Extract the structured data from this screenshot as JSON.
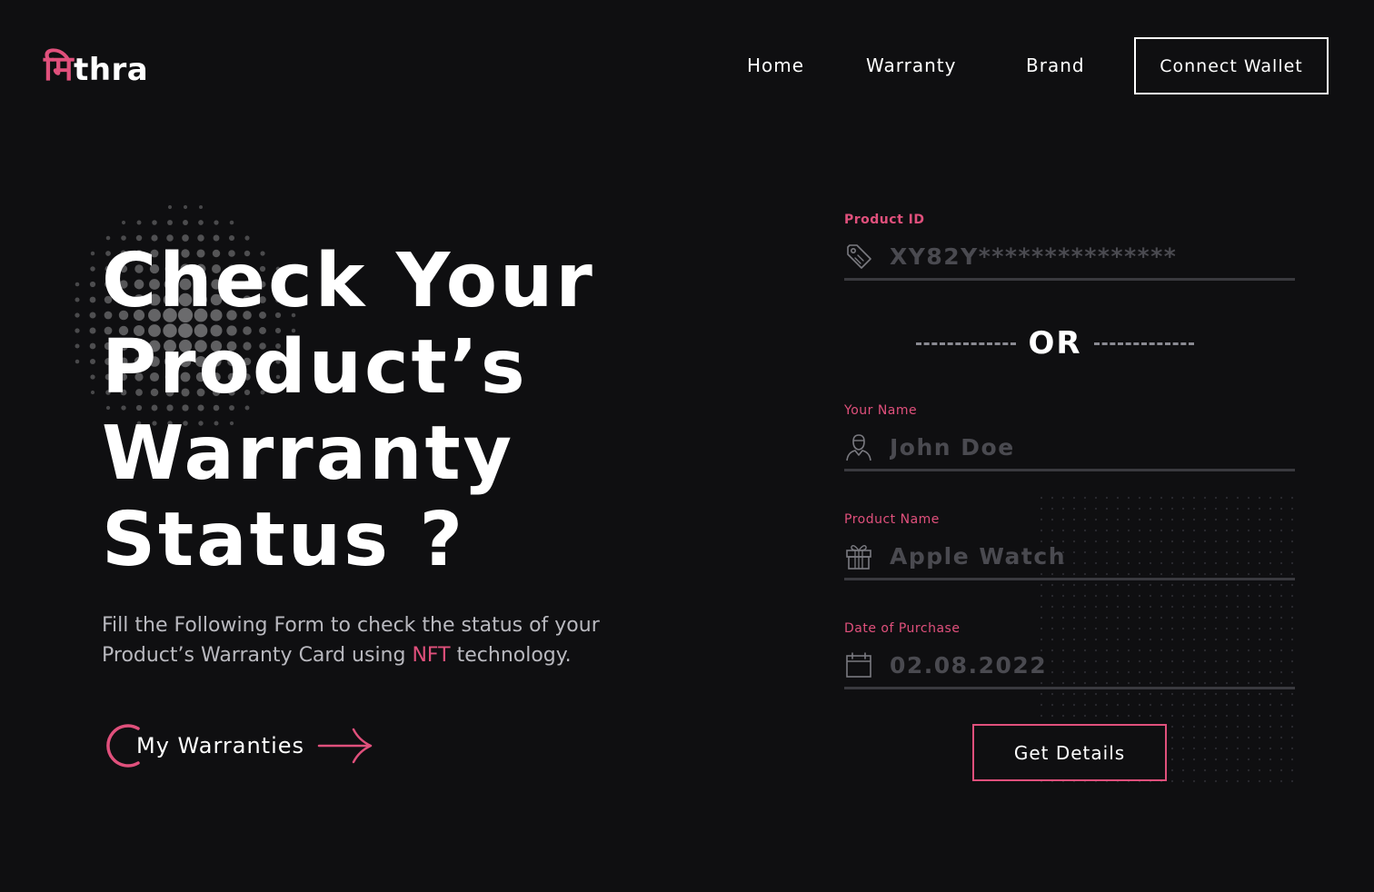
{
  "brand": {
    "logo_deva": "मि",
    "logo_latin": "thra"
  },
  "nav": {
    "home": "Home",
    "warranty": "Warranty",
    "brand": "Brand",
    "connect_wallet": "Connect Wallet"
  },
  "hero": {
    "title_lines": [
      "Check Your",
      "Product’s",
      "Warranty",
      "Status ?"
    ],
    "desc_before": "Fill the Following Form to check the status of your Product’s Warranty Card using ",
    "desc_accent": "NFT",
    "desc_after": " technology.",
    "cta": "My Warranties"
  },
  "form": {
    "product_id": {
      "label": "Product ID",
      "placeholder": "XY82Y***************",
      "icon": "tag-icon"
    },
    "or_text": "OR",
    "your_name": {
      "label": "Your Name",
      "placeholder": "John Doe",
      "icon": "user-icon"
    },
    "product_name": {
      "label": "Product Name",
      "placeholder": "Apple Watch",
      "icon": "gift-icon"
    },
    "date_of_purchase": {
      "label": "Date of Purchase",
      "placeholder": "02.08.2022",
      "icon": "calendar-icon"
    },
    "submit": "Get Details"
  },
  "colors": {
    "background": "#0f0f11",
    "accent": "#e0507c",
    "text": "#ffffff",
    "muted_text": "#b9b9bf",
    "placeholder": "#4a4a50",
    "underline": "#3a3a3f"
  }
}
